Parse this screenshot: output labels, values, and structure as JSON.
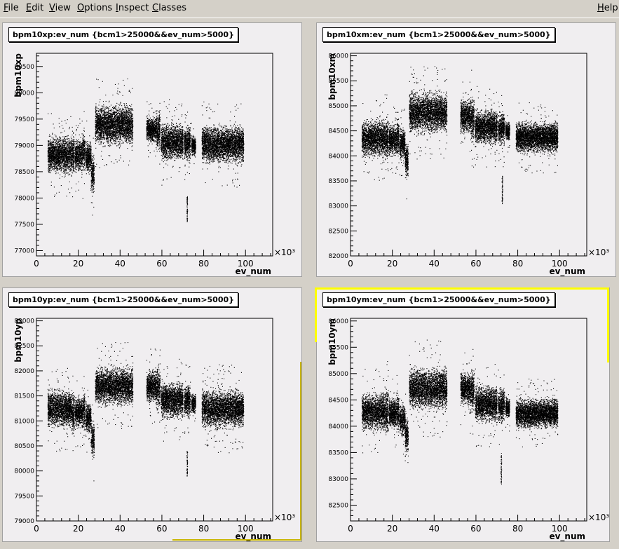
{
  "menubar": {
    "items": [
      {
        "label": "File",
        "accel": "F"
      },
      {
        "label": "Edit",
        "accel": "E"
      },
      {
        "label": "View",
        "accel": "V"
      },
      {
        "label": "Options",
        "accel": "O"
      },
      {
        "label": "Inspect",
        "accel": "I"
      },
      {
        "label": "Classes",
        "accel": "C"
      }
    ],
    "help": {
      "label": "Help",
      "accel": "H"
    }
  },
  "colors": {
    "pad_background": "#f0eef0",
    "marker": "#000000",
    "active_highlight": "#ffff00",
    "pad_frame": "#c8b400"
  },
  "chart_data": [
    {
      "type": "scatter",
      "title": "bpm10xp:ev_num {bcm1>25000&&ev_num>5000}",
      "xlabel": "ev_num",
      "ylabel": "bpm10xp",
      "x_multiplier": "×10³",
      "xlim": [
        0,
        113
      ],
      "ylim": [
        76900,
        80750
      ],
      "xticks": [
        0,
        20,
        40,
        60,
        80,
        100
      ],
      "yticks": [
        77000,
        77500,
        78000,
        78500,
        79000,
        79500,
        80000,
        80500
      ],
      "segments": [
        {
          "x": [
            5.3,
            16.5
          ],
          "y": [
            78450,
            79200
          ]
        },
        {
          "x": [
            16.5,
            18.0
          ],
          "y": [
            78400,
            79300
          ]
        },
        {
          "x": [
            18.3,
            22.0
          ],
          "y": [
            78500,
            79150
          ]
        },
        {
          "x": [
            22.0,
            23.0
          ],
          "y": [
            78450,
            79300
          ]
        },
        {
          "x": [
            23.3,
            26.0
          ],
          "y": [
            78450,
            79100
          ]
        },
        {
          "x": [
            26.0,
            27.5
          ],
          "y": [
            78050,
            78900
          ]
        },
        {
          "x": [
            28.0,
            46.0
          ],
          "y": [
            79000,
            79800
          ]
        },
        {
          "x": [
            52.5,
            57.0
          ],
          "y": [
            79050,
            79550
          ]
        },
        {
          "x": [
            57.0,
            59.0
          ],
          "y": [
            78900,
            79700
          ]
        },
        {
          "x": [
            59.5,
            70.0
          ],
          "y": [
            78700,
            79450
          ]
        },
        {
          "x": [
            70.5,
            73.5
          ],
          "y": [
            78700,
            79400
          ]
        },
        {
          "x": [
            74.0,
            76.0
          ],
          "y": [
            78800,
            79200
          ]
        },
        {
          "x": [
            79.0,
            99.0
          ],
          "y": [
            78650,
            79400
          ]
        }
      ],
      "spikes": [
        {
          "x": 72.0,
          "y": [
            77550,
            78050
          ]
        }
      ]
    },
    {
      "type": "scatter",
      "title": "bpm10xm:ev_num {bcm1>25000&&ev_num>5000}",
      "xlabel": "ev_num",
      "ylabel": "bpm10xm",
      "x_multiplier": "×10³",
      "xlim": [
        0,
        113
      ],
      "ylim": [
        82000,
        86050
      ],
      "xticks": [
        0,
        20,
        40,
        60,
        80,
        100
      ],
      "yticks": [
        82000,
        82500,
        83000,
        83500,
        84000,
        84500,
        85000,
        85500,
        86000
      ],
      "segments": [
        {
          "x": [
            5.3,
            16.5
          ],
          "y": [
            83950,
            84750
          ]
        },
        {
          "x": [
            16.5,
            18.0
          ],
          "y": [
            83900,
            84800
          ]
        },
        {
          "x": [
            18.3,
            22.0
          ],
          "y": [
            84000,
            84650
          ]
        },
        {
          "x": [
            22.0,
            23.0
          ],
          "y": [
            83950,
            84800
          ]
        },
        {
          "x": [
            23.3,
            26.0
          ],
          "y": [
            83900,
            84600
          ]
        },
        {
          "x": [
            26.0,
            27.5
          ],
          "y": [
            83550,
            84300
          ]
        },
        {
          "x": [
            28.0,
            46.0
          ],
          "y": [
            84450,
            85300
          ]
        },
        {
          "x": [
            52.5,
            57.0
          ],
          "y": [
            84450,
            85150
          ]
        },
        {
          "x": [
            57.0,
            59.0
          ],
          "y": [
            84300,
            85200
          ]
        },
        {
          "x": [
            59.5,
            70.0
          ],
          "y": [
            84200,
            84950
          ]
        },
        {
          "x": [
            70.5,
            73.5
          ],
          "y": [
            84200,
            84900
          ]
        },
        {
          "x": [
            74.0,
            76.0
          ],
          "y": [
            84300,
            84700
          ]
        },
        {
          "x": [
            79.0,
            99.0
          ],
          "y": [
            84050,
            84700
          ]
        }
      ],
      "spikes": [
        {
          "x": 72.5,
          "y": [
            83050,
            83600
          ]
        }
      ]
    },
    {
      "type": "scatter",
      "title": "bpm10yp:ev_num {bcm1>25000&&ev_num>5000}",
      "xlabel": "ev_num",
      "ylabel": "bpm10yp",
      "x_multiplier": "×10³",
      "xlim": [
        0,
        113
      ],
      "ylim": [
        79000,
        83050
      ],
      "xticks": [
        0,
        20,
        40,
        60,
        80,
        100
      ],
      "yticks": [
        79000,
        79500,
        80000,
        80500,
        81000,
        81500,
        82000,
        82500,
        83000
      ],
      "segments": [
        {
          "x": [
            5.3,
            16.5
          ],
          "y": [
            80850,
            81650
          ]
        },
        {
          "x": [
            16.5,
            18.0
          ],
          "y": [
            80700,
            81600
          ]
        },
        {
          "x": [
            18.3,
            22.0
          ],
          "y": [
            80850,
            81500
          ]
        },
        {
          "x": [
            22.0,
            23.0
          ],
          "y": [
            80800,
            81700
          ]
        },
        {
          "x": [
            23.3,
            26.0
          ],
          "y": [
            80750,
            81400
          ]
        },
        {
          "x": [
            26.0,
            27.5
          ],
          "y": [
            80250,
            81050
          ]
        },
        {
          "x": [
            28.0,
            46.0
          ],
          "y": [
            81300,
            82100
          ]
        },
        {
          "x": [
            52.5,
            57.0
          ],
          "y": [
            81350,
            82050
          ]
        },
        {
          "x": [
            57.0,
            59.0
          ],
          "y": [
            81200,
            82100
          ]
        },
        {
          "x": [
            59.5,
            70.0
          ],
          "y": [
            81050,
            81800
          ]
        },
        {
          "x": [
            70.5,
            73.5
          ],
          "y": [
            81050,
            81750
          ]
        },
        {
          "x": [
            74.0,
            76.0
          ],
          "y": [
            81150,
            81550
          ]
        },
        {
          "x": [
            79.0,
            99.0
          ],
          "y": [
            80850,
            81650
          ]
        }
      ],
      "spikes": [
        {
          "x": 72.0,
          "y": [
            79900,
            80400
          ]
        }
      ]
    },
    {
      "type": "scatter",
      "title": "bpm10ym:ev_num {bcm1>25000&&ev_num>5000}",
      "xlabel": "ev_num",
      "ylabel": "bpm10ym",
      "x_multiplier": "×10³",
      "xlim": [
        0,
        113
      ],
      "ylim": [
        82200,
        86050
      ],
      "xticks": [
        0,
        20,
        40,
        60,
        80,
        100
      ],
      "yticks": [
        82500,
        83000,
        83500,
        84000,
        84500,
        85000,
        85500,
        86000
      ],
      "segments": [
        {
          "x": [
            5.3,
            16.5
          ],
          "y": [
            83900,
            84650
          ]
        },
        {
          "x": [
            16.5,
            18.0
          ],
          "y": [
            83800,
            84700
          ]
        },
        {
          "x": [
            18.3,
            22.0
          ],
          "y": [
            83950,
            84550
          ]
        },
        {
          "x": [
            22.0,
            23.0
          ],
          "y": [
            83850,
            84700
          ]
        },
        {
          "x": [
            23.3,
            26.0
          ],
          "y": [
            83800,
            84450
          ]
        },
        {
          "x": [
            26.0,
            27.5
          ],
          "y": [
            83450,
            84200
          ]
        },
        {
          "x": [
            28.0,
            46.0
          ],
          "y": [
            84300,
            85150
          ]
        },
        {
          "x": [
            52.5,
            57.0
          ],
          "y": [
            84400,
            85050
          ]
        },
        {
          "x": [
            57.0,
            59.0
          ],
          "y": [
            84250,
            85100
          ]
        },
        {
          "x": [
            59.5,
            70.0
          ],
          "y": [
            84050,
            84800
          ]
        },
        {
          "x": [
            70.5,
            73.5
          ],
          "y": [
            84050,
            84750
          ]
        },
        {
          "x": [
            74.0,
            76.0
          ],
          "y": [
            84150,
            84550
          ]
        },
        {
          "x": [
            79.0,
            99.0
          ],
          "y": [
            83950,
            84550
          ]
        }
      ],
      "spikes": [
        {
          "x": 72.0,
          "y": [
            82900,
            83500
          ]
        }
      ]
    }
  ]
}
